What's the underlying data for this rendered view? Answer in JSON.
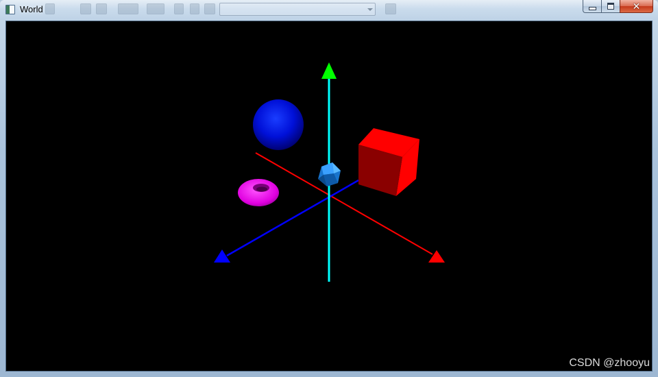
{
  "window": {
    "title": "World",
    "icon": "app-window-icon",
    "controls": {
      "minimize_icon": "minimize-icon",
      "maximize_icon": "restore-icon",
      "close_icon": "close-icon",
      "close_glyph": "✕"
    }
  },
  "scene": {
    "axes": {
      "x_color": "#ff0000",
      "y_color": "#00ff00",
      "y_shaft_color": "#00ffff",
      "z_color": "#0000ff"
    },
    "objects": {
      "sphere_color": "#0000ff",
      "cube_color": "#ff0000",
      "torus_color": "#ff00ff",
      "icosahedron_color": "#1e90ff"
    },
    "background": "#000000"
  },
  "watermark": {
    "text": "CSDN @zhooyu"
  }
}
